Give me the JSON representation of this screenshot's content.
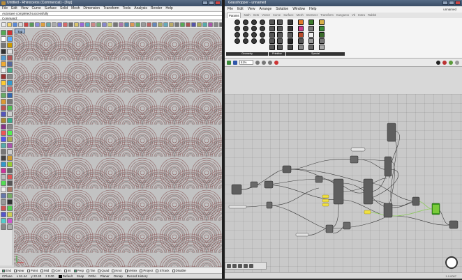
{
  "rhino": {
    "title": "Untitled - Rhinoceros (Commercial) - [Top]",
    "menu": [
      "File",
      "Edit",
      "View",
      "Curve",
      "Surface",
      "Solid",
      "Mesh",
      "Dimension",
      "Transform",
      "Tools",
      "Analysis",
      "Render",
      "Help"
    ],
    "command_history": "Autosave completed successfully",
    "command_prompt": "Command:",
    "viewport_label": "Top",
    "osnaps": [
      {
        "label": "End",
        "on": true
      },
      {
        "label": "Near",
        "on": false
      },
      {
        "label": "Point",
        "on": false
      },
      {
        "label": "Mid",
        "on": false
      },
      {
        "label": "Cen",
        "on": false
      },
      {
        "label": "Int",
        "on": false
      },
      {
        "label": "Perp",
        "on": true
      },
      {
        "label": "Tan",
        "on": false
      },
      {
        "label": "Quad",
        "on": false
      },
      {
        "label": "Knot",
        "on": false
      },
      {
        "label": "Vertex",
        "on": false
      },
      {
        "label": "Project",
        "on": false
      },
      {
        "label": "STrack",
        "on": false
      },
      {
        "label": "Disable",
        "on": false
      }
    ],
    "status": {
      "plane": "CPlane",
      "x": "x 61.44",
      "y": "y 22.40",
      "z": "z 0.00",
      "layer": "Default",
      "toggles": [
        "Snap",
        "Ortho",
        "Planar",
        "Osnap",
        "Record History"
      ]
    }
  },
  "grasshopper": {
    "title": "Grasshopper - unnamed",
    "document": "unnamed",
    "menu": [
      "File",
      "Edit",
      "View",
      "Arrange",
      "Solution",
      "Window",
      "Help"
    ],
    "tabs": [
      "Params",
      "Math",
      "Sets",
      "Vector",
      "Curve",
      "Surface",
      "Mesh",
      "Intersect",
      "Transform",
      "Kangaroo",
      "Vb",
      "Extra",
      "Rabbit"
    ],
    "active_tab": "Params",
    "ribbon_groups": [
      "Geometry",
      "Primitive",
      "Special"
    ],
    "zoom": "51%",
    "version": "1.0.0007",
    "colors": {
      "canvas": "#c9c9c9",
      "wire": "#3a3a3a",
      "panel_yellow": "#f0e040",
      "preview_green": "#3a9a1a"
    }
  }
}
